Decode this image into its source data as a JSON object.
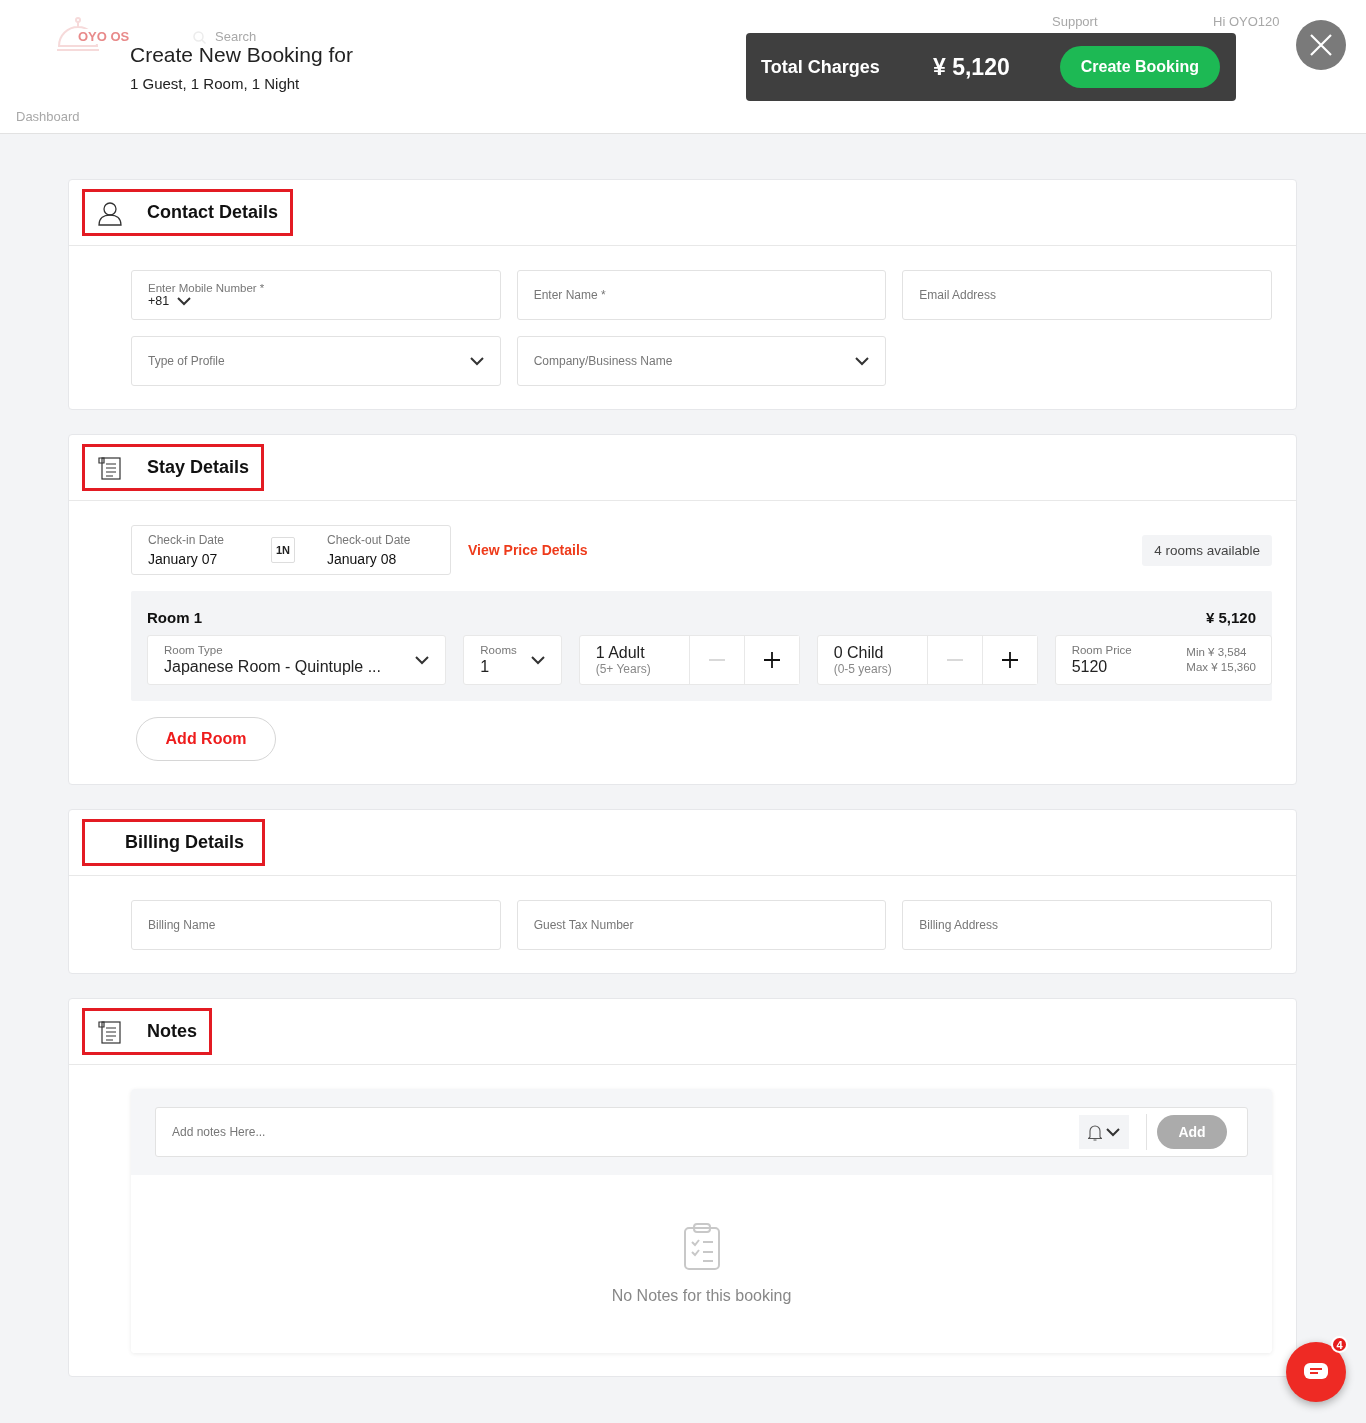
{
  "background_app": {
    "logo": "OYO OS",
    "search": "Search",
    "support": "Support",
    "user": "Hi OYO120",
    "breadcrumb": "Dashboard"
  },
  "header": {
    "title": "Create New Booking for",
    "subtitle": "1 Guest, 1 Room, 1 Night",
    "total_label": "Total Charges",
    "total_value": "¥ 5,120",
    "create_button": "Create Booking"
  },
  "contact": {
    "title": "Contact Details",
    "highlighted": true,
    "fields": [
      {
        "kind": "phone",
        "label": "Enter Mobile Number *",
        "value": "+81"
      },
      {
        "kind": "text",
        "placeholder": "Enter Name *"
      },
      {
        "kind": "text",
        "placeholder": "Email Address"
      },
      {
        "kind": "select",
        "placeholder": "Type of Profile"
      },
      {
        "kind": "select",
        "placeholder": "Company/Business Name"
      }
    ]
  },
  "stay": {
    "title": "Stay Details",
    "highlighted": true,
    "checkin_label": "Check-in Date",
    "checkin_value": "January 07",
    "nights": "1N",
    "checkout_label": "Check-out Date",
    "checkout_value": "January 08",
    "price_link": "View Price Details",
    "availability": "4 rooms available",
    "rooms": [
      {
        "title": "Room 1",
        "price": "¥ 5,120",
        "room_type_label": "Room Type",
        "room_type_value": "Japanese Room - Quintuple ...",
        "rooms_label": "Rooms",
        "rooms_value": "1",
        "adult": {
          "value": "1 Adult",
          "note": "(5+ Years)",
          "minus_disabled": true
        },
        "child": {
          "value": "0 Child",
          "note": "(0-5 years)",
          "minus_disabled": true
        },
        "price_label": "Room Price",
        "price_value": "5120",
        "min": "Min ¥ 3,584",
        "max": "Max ¥ 15,360"
      }
    ],
    "add_room": "Add Room"
  },
  "billing": {
    "title": "Billing Details",
    "highlighted": true,
    "fields": [
      {
        "kind": "text",
        "placeholder": "Billing Name"
      },
      {
        "kind": "text",
        "placeholder": "Guest Tax Number"
      },
      {
        "kind": "text",
        "placeholder": "Billing Address"
      }
    ]
  },
  "notes": {
    "title": "Notes",
    "highlighted": true,
    "placeholder": "Add notes Here...",
    "add_button": "Add",
    "add_disabled": true,
    "empty": "No Notes for this booking"
  },
  "chat": {
    "badge": "4"
  }
}
